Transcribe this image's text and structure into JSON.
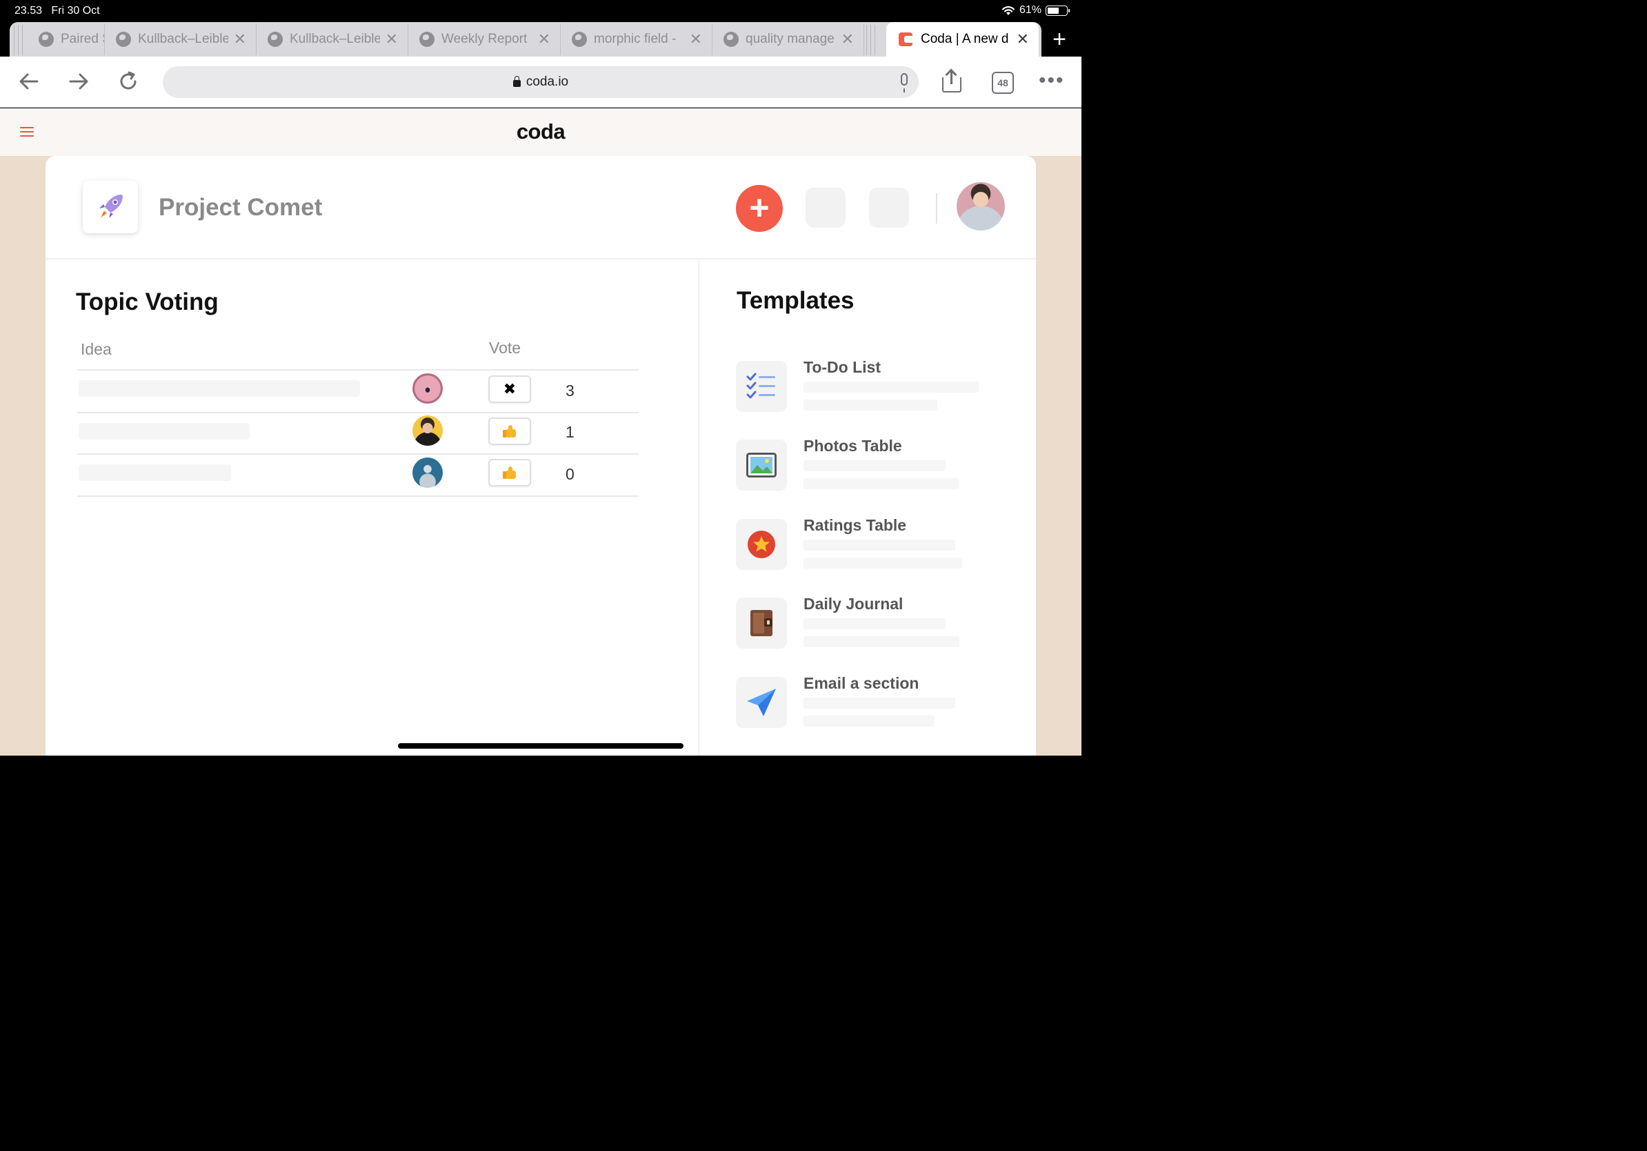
{
  "status": {
    "time": "23.53",
    "date": "Fri 30 Oct",
    "battery": "61%"
  },
  "tabs": [
    {
      "label": "Paired S"
    },
    {
      "label": "Kullback–Leible"
    },
    {
      "label": "Kullback–Leible"
    },
    {
      "label": "Weekly Report"
    },
    {
      "label": "morphic field -"
    },
    {
      "label": "quality manage"
    },
    {
      "label": "Coda | A new d",
      "active": true
    }
  ],
  "toolbar": {
    "url": "coda.io",
    "tab_count": "48"
  },
  "header": {
    "logo": "coda"
  },
  "doc": {
    "title": "Project Comet",
    "add_label": "+"
  },
  "voting": {
    "title": "Topic Voting",
    "col_idea": "Idea",
    "col_vote": "Vote",
    "rows": [
      {
        "vote_symbol": "✖",
        "count": "3"
      },
      {
        "vote_symbol": "thumbs-up",
        "count": "1"
      },
      {
        "vote_symbol": "thumbs-up",
        "count": "0"
      }
    ]
  },
  "templates": {
    "title": "Templates",
    "items": [
      {
        "name": "To-Do List",
        "icon": "checklist-icon"
      },
      {
        "name": "Photos Table",
        "icon": "photo-icon"
      },
      {
        "name": "Ratings Table",
        "icon": "star-icon"
      },
      {
        "name": "Daily Journal",
        "icon": "journal-icon"
      },
      {
        "name": "Email a section",
        "icon": "paper-plane-icon"
      }
    ]
  },
  "colors": {
    "accent": "#f25c48",
    "page_bg": "#ecdccb",
    "header_bg": "#f9f6f3"
  }
}
